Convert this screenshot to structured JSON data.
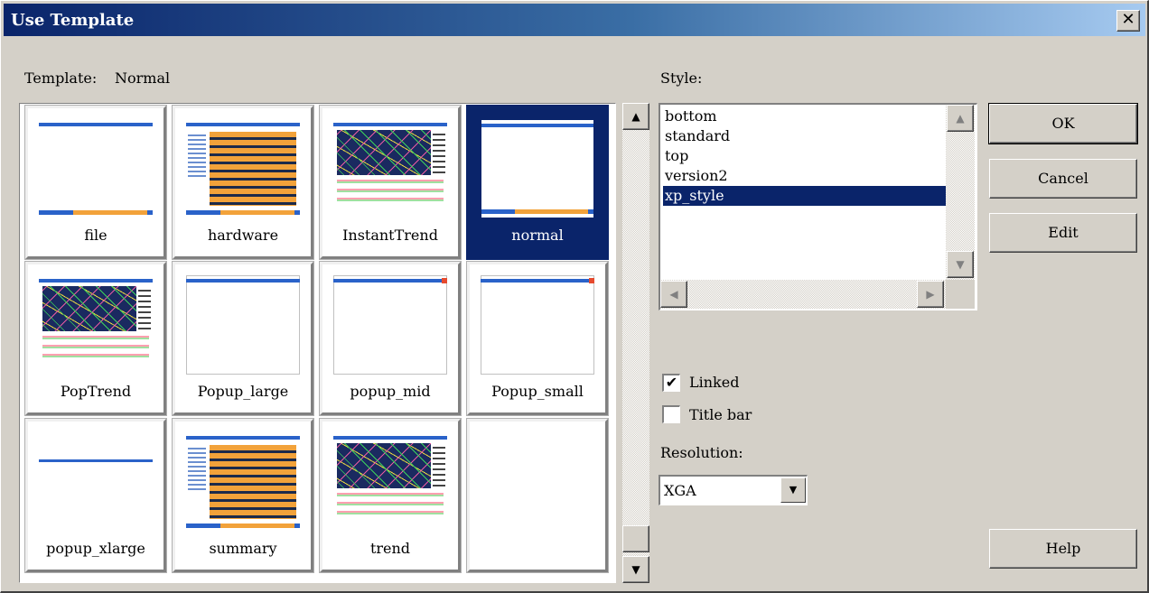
{
  "window": {
    "title": "Use Template",
    "close_glyph": "✕"
  },
  "template_label": "Template:",
  "template_value": "Normal",
  "templates": [
    {
      "name": "file",
      "thumb": "blank-bars"
    },
    {
      "name": "hardware",
      "thumb": "hardware"
    },
    {
      "name": "InstantTrend",
      "thumb": "trend"
    },
    {
      "name": "normal",
      "thumb": "blank-bars",
      "selected": true
    },
    {
      "name": "PopTrend",
      "thumb": "trend"
    },
    {
      "name": "Popup_large",
      "thumb": "popup"
    },
    {
      "name": "popup_mid",
      "thumb": "popup-red"
    },
    {
      "name": "Popup_small",
      "thumb": "popup-red"
    },
    {
      "name": "popup_xlarge",
      "thumb": "top-bar"
    },
    {
      "name": "summary",
      "thumb": "hardware"
    },
    {
      "name": "trend",
      "thumb": "trend"
    },
    {
      "name": "",
      "thumb": "empty"
    }
  ],
  "style": {
    "label": "Style:",
    "items": [
      "bottom",
      "standard",
      "top",
      "version2",
      "xp_style"
    ],
    "selected_index": 4
  },
  "buttons": {
    "ok": "OK",
    "cancel": "Cancel",
    "edit": "Edit",
    "help": "Help"
  },
  "linked": {
    "label": "Linked",
    "checked": true
  },
  "title_bar": {
    "label": "Title bar",
    "checked": false
  },
  "resolution": {
    "label": "Resolution:",
    "value": "XGA"
  },
  "glyphs": {
    "up": "▲",
    "down": "▼",
    "left": "◀",
    "right": "▶",
    "check": "✔"
  }
}
